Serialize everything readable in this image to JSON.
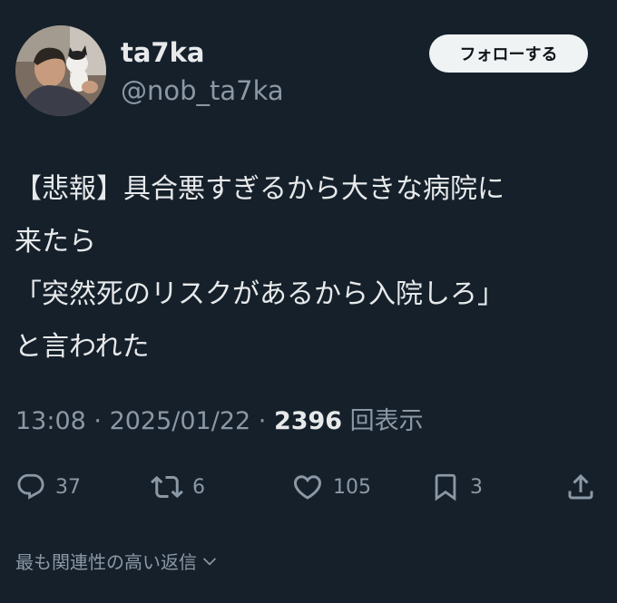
{
  "user": {
    "display_name": "ta7ka",
    "handle": "@nob_ta7ka"
  },
  "follow_button": {
    "label": "フォローする"
  },
  "tweet": {
    "lines": [
      "【悲報】具合悪すぎるから大きな病院に",
      "来たら",
      "「突然死のリスクがあるから入院しろ」",
      "と言われた"
    ]
  },
  "meta": {
    "time": "13:08",
    "separator": " · ",
    "date": "2025/01/22",
    "views_count": "2396",
    "views_label": " 回表示"
  },
  "actions": {
    "reply_count": "37",
    "retweet_count": "6",
    "like_count": "105",
    "bookmark_count": "3"
  },
  "replies_sort": {
    "label": "最も関連性の高い返信"
  },
  "colors": {
    "background": "#15202b",
    "text_primary": "#e7e9ea",
    "text_secondary": "#8b98a5",
    "button_bg": "#eff3f4"
  }
}
